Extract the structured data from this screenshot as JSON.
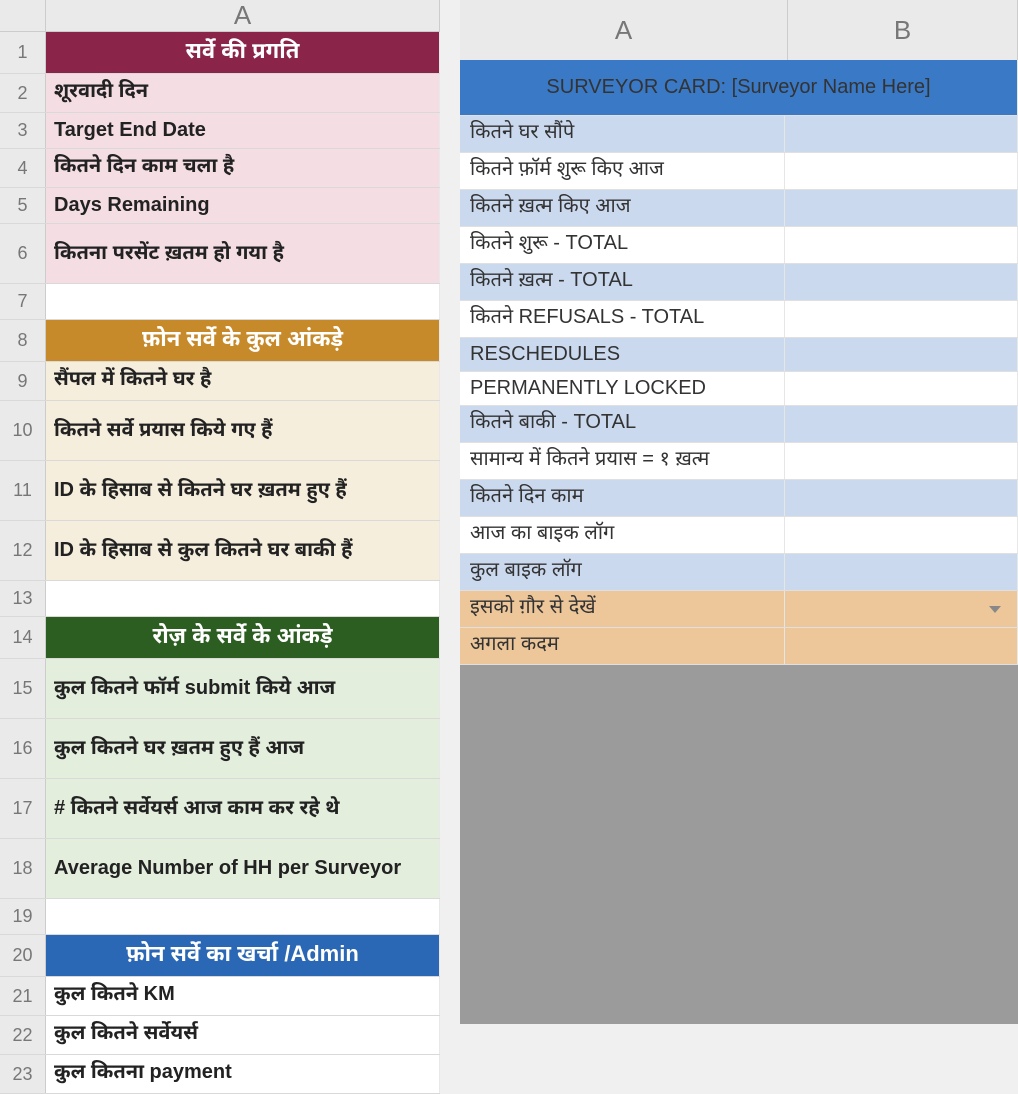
{
  "left": {
    "colHeaders": [
      "A"
    ],
    "rows": [
      {
        "n": "1",
        "cls": "bg-maroon header-cell",
        "text": "सर्वे की प्रगति"
      },
      {
        "n": "2",
        "cls": "bg-pink",
        "text": "शूरवादी दिन"
      },
      {
        "n": "3",
        "cls": "bg-pink",
        "text": "Target End Date"
      },
      {
        "n": "4",
        "cls": "bg-pink",
        "text": "कितने दिन काम चला है"
      },
      {
        "n": "5",
        "cls": "bg-pink",
        "text": "Days Remaining"
      },
      {
        "n": "6",
        "cls": "bg-pink",
        "text": "कितना परसेंट ख़तम हो गया है"
      },
      {
        "n": "7",
        "cls": "bg-empty",
        "text": ""
      },
      {
        "n": "8",
        "cls": "bg-ochre header-cell",
        "text": "फ़ोन सर्वे के कुल आंकड़े"
      },
      {
        "n": "9",
        "cls": "bg-cream",
        "text": "सैंपल में कितने घर है"
      },
      {
        "n": "10",
        "cls": "bg-cream",
        "text": "कितने सर्वे प्रयास किये गए हैं"
      },
      {
        "n": "11",
        "cls": "bg-cream",
        "text": "ID के हिसाब से कितने घर ख़तम हुए हैं"
      },
      {
        "n": "12",
        "cls": "bg-cream",
        "text": "ID के हिसाब से कुल कितने घर बाकी हैं"
      },
      {
        "n": "13",
        "cls": "bg-empty",
        "text": ""
      },
      {
        "n": "14",
        "cls": "bg-dgreen header-cell",
        "text": "रोज़ के सर्वे के आंकड़े"
      },
      {
        "n": "15",
        "cls": "bg-lgreen",
        "text": "कुल कितने फॉर्म submit किये आज"
      },
      {
        "n": "16",
        "cls": "bg-lgreen",
        "text": "कुल कितने घर ख़तम हुए हैं आज"
      },
      {
        "n": "17",
        "cls": "bg-lgreen",
        "text": "# कितने सर्वेयर्स आज काम कर रहे थे"
      },
      {
        "n": "18",
        "cls": "bg-lgreen",
        "text": "Average Number of HH per Surveyor"
      },
      {
        "n": "19",
        "cls": "bg-empty",
        "text": ""
      },
      {
        "n": "20",
        "cls": "bg-dblue header-cell",
        "text": "फ़ोन सर्वे का खर्चा /Admin"
      },
      {
        "n": "21",
        "cls": "bg-lgray",
        "text": "कुल कितने KM"
      },
      {
        "n": "22",
        "cls": "bg-lgray",
        "text": "कुल कितने सर्वेयर्स"
      },
      {
        "n": "23",
        "cls": "bg-lgray",
        "text": "कुल कितना payment"
      }
    ]
  },
  "right": {
    "colHeaders": [
      "A",
      "B"
    ],
    "header": "SURVEYOR CARD: [Surveyor Name Here]",
    "rows": [
      {
        "cls": "bg-ltblue",
        "a": "कितने घर सौंपे",
        "b": ""
      },
      {
        "cls": "bg-white",
        "a": "कितने फ़ॉर्म शुरू किए आज",
        "b": ""
      },
      {
        "cls": "bg-ltblue",
        "a": "कितने ख़त्म किए आज",
        "b": ""
      },
      {
        "cls": "bg-white",
        "a": "कितने शुरू - TOTAL",
        "b": ""
      },
      {
        "cls": "bg-ltblue",
        "a": "कितने ख़त्म - TOTAL",
        "b": ""
      },
      {
        "cls": "bg-white",
        "a": "कितने REFUSALS - TOTAL",
        "b": ""
      },
      {
        "cls": "bg-ltblue",
        "a": "RESCHEDULES",
        "b": ""
      },
      {
        "cls": "bg-white",
        "a": "PERMANENTLY LOCKED",
        "b": ""
      },
      {
        "cls": "bg-ltblue",
        "a": "कितने बाकी - TOTAL",
        "b": ""
      },
      {
        "cls": "bg-white",
        "a": "सामान्य में कितने प्रयास = १ ख़त्म",
        "b": ""
      },
      {
        "cls": "bg-ltblue",
        "a": "कितने दिन काम",
        "b": ""
      },
      {
        "cls": "bg-white",
        "a": "आज का बाइक लॉग",
        "b": ""
      },
      {
        "cls": "bg-ltblue",
        "a": "कुल बाइक लॉग",
        "b": ""
      },
      {
        "cls": "bg-tan",
        "a": "इसको ग़ौर से देखें",
        "b": "",
        "dropdown": true
      },
      {
        "cls": "bg-tan",
        "a": "अगला कदम",
        "b": ""
      }
    ]
  }
}
